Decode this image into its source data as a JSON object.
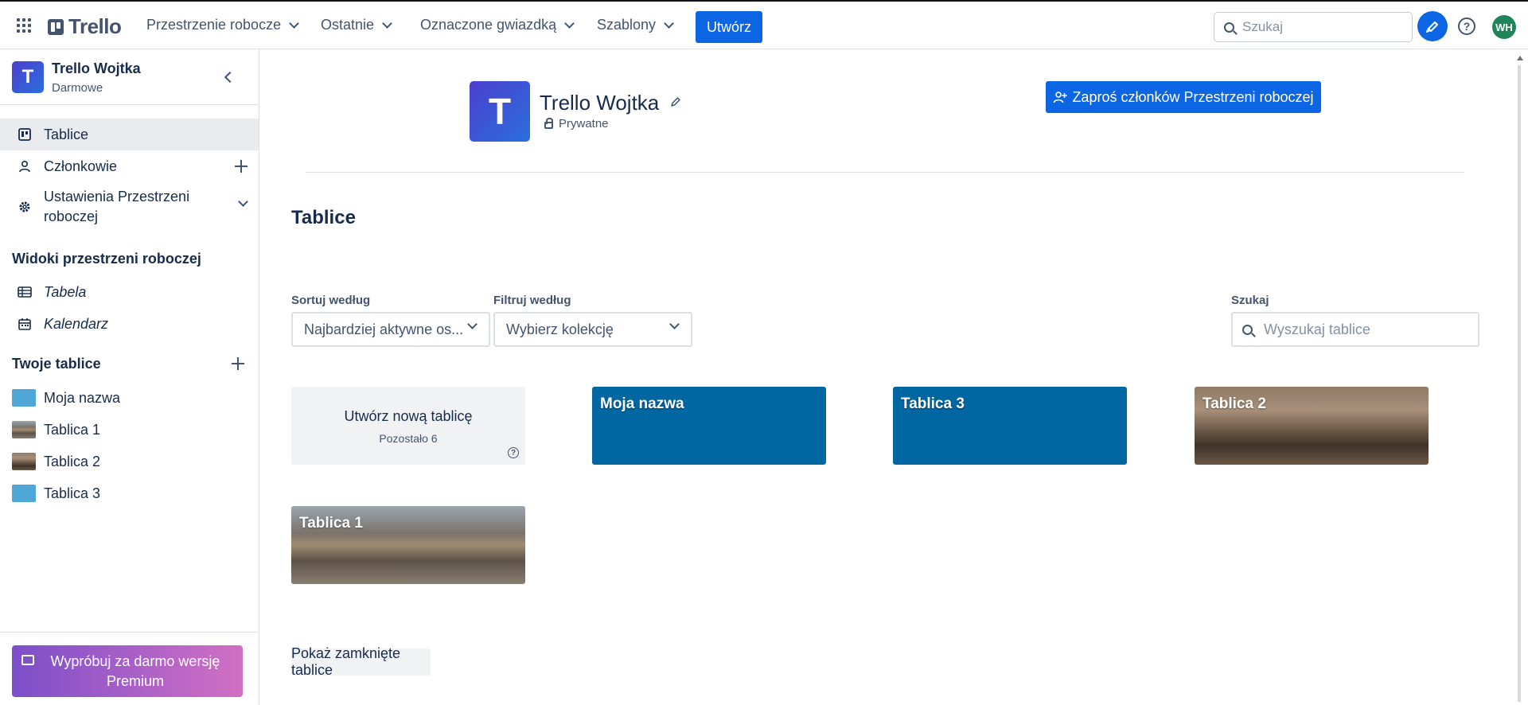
{
  "topbar": {
    "logo": "Trello",
    "menus": [
      "Przestrzenie robocze",
      "Ostatnie",
      "Oznaczone gwiazdką",
      "Szablony"
    ],
    "create_label": "Utwórz",
    "search_placeholder": "Szukaj",
    "help_label": "?",
    "avatar_initials": "WH"
  },
  "sidebar": {
    "workspace_initial": "T",
    "workspace_name": "Trello Wojtka",
    "workspace_plan": "Darmowe",
    "items": [
      {
        "label": "Tablice",
        "icon": "board-icon"
      },
      {
        "label": "Członkowie",
        "icon": "person-icon"
      },
      {
        "label": "Ustawienia Przestrzeni roboczej",
        "icon": "gear-icon"
      }
    ],
    "views_title": "Widoki przestrzeni roboczej",
    "views": [
      {
        "label": "Tabela",
        "icon": "table-icon"
      },
      {
        "label": "Kalendarz",
        "icon": "calendar-icon"
      }
    ],
    "boards_title": "Twoje tablice",
    "boards": [
      {
        "label": "Moja nazwa",
        "color": "#4fa7d8"
      },
      {
        "label": "Tablica 1",
        "color": "image"
      },
      {
        "label": "Tablica 2",
        "color": "image"
      },
      {
        "label": "Tablica 3",
        "color": "#4fa7d8"
      }
    ],
    "premium_label": "Wypróbuj za darmo wersję Premium"
  },
  "main": {
    "workspace_initial": "T",
    "workspace_name": "Trello Wojtka",
    "privacy": "Prywatne",
    "invite_label": "Zaproś członków Przestrzeni roboczej",
    "boards_title": "Tablice",
    "sort_label": "Sortuj według",
    "sort_value": "Najbardziej aktywne os...",
    "filter_label": "Filtruj według",
    "filter_value": "Wybierz kolekcję",
    "search_label": "Szukaj",
    "search_placeholder": "Wyszukaj tablice",
    "new_board_label": "Utwórz nową tablicę",
    "new_board_remaining": "Pozostało 6",
    "cards": [
      "Moja nazwa",
      "Tablica 3",
      "Tablica 2",
      "Tablica 1"
    ],
    "closed_boards_label": "Pokaż zamknięte tablice"
  },
  "colors": {
    "primary": "#0c66e4",
    "board_blue": "#0067a3",
    "sidebar_active": "#e9ebee"
  }
}
